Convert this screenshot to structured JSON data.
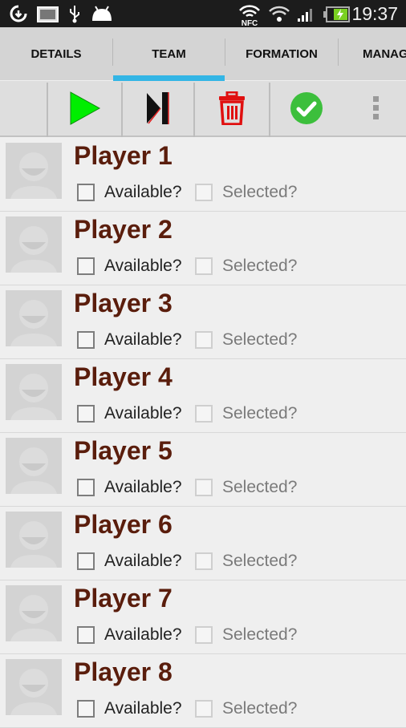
{
  "status_bar": {
    "time": "19:37",
    "icons": [
      "sync-icon",
      "image-icon",
      "usb-icon",
      "android-icon",
      "nfc-icon",
      "wifi-icon",
      "signal-icon",
      "battery-charging-icon"
    ],
    "nfc_label": "NFC"
  },
  "tabs": [
    {
      "label": "DETAILS",
      "active": false
    },
    {
      "label": "TEAM",
      "active": true
    },
    {
      "label": "FORMATION",
      "active": false
    },
    {
      "label": "MANAG",
      "active": false
    }
  ],
  "toolbar": {
    "buttons": [
      "play",
      "skip-next",
      "delete",
      "confirm",
      "overflow-menu"
    ],
    "colors": {
      "play": "#00ee00",
      "delete": "#e01010",
      "confirm": "#3cbf3c",
      "accent": "#33b5e5"
    }
  },
  "players": [
    {
      "name": "Player 1",
      "available_label": "Available?",
      "selected_label": "Selected?",
      "available": false,
      "selected": false
    },
    {
      "name": "Player 2",
      "available_label": "Available?",
      "selected_label": "Selected?",
      "available": false,
      "selected": false
    },
    {
      "name": "Player 3",
      "available_label": "Available?",
      "selected_label": "Selected?",
      "available": false,
      "selected": false
    },
    {
      "name": "Player 4",
      "available_label": "Available?",
      "selected_label": "Selected?",
      "available": false,
      "selected": false
    },
    {
      "name": "Player 5",
      "available_label": "Available?",
      "selected_label": "Selected?",
      "available": false,
      "selected": false
    },
    {
      "name": "Player 6",
      "available_label": "Available?",
      "selected_label": "Selected?",
      "available": false,
      "selected": false
    },
    {
      "name": "Player 7",
      "available_label": "Available?",
      "selected_label": "Selected?",
      "available": false,
      "selected": false
    },
    {
      "name": "Player 8",
      "available_label": "Available?",
      "selected_label": "Selected?",
      "available": false,
      "selected": false
    }
  ]
}
